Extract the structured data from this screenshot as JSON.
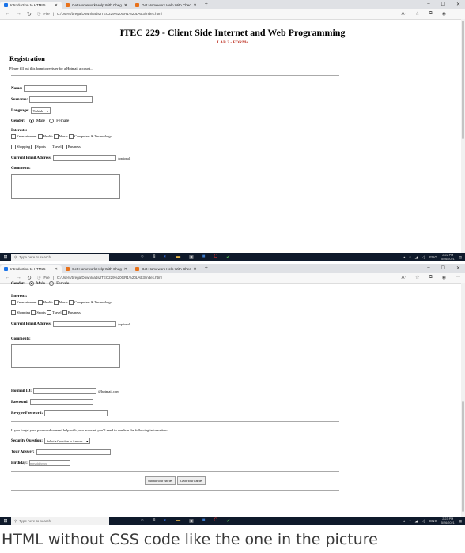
{
  "browser": {
    "tabs": [
      {
        "title": "Introduction to HTML5",
        "color": "#1a73e8"
      },
      {
        "title": "Get Homework Help With Cheg",
        "color": "#e8711a"
      },
      {
        "title": "Get Homework Help With Chec",
        "color": "#e8711a"
      }
    ],
    "new_tab": "+",
    "window_controls": [
      "–",
      "☐",
      "✕"
    ],
    "file_label": "File",
    "url": "C:/Users/brega/Downloads/ITEC229%20GR1%20LAB3/index.html"
  },
  "page": {
    "title": "ITEC 229 - Client Side Internet and Web Programming",
    "subtitle": "LAB 3 - FORMs",
    "heading": "Registration",
    "intro": "Please fill out this form to register for a Hotmail account...",
    "name_label": "Name:",
    "surname_label": "Surname:",
    "language_label": "Language:",
    "language_value": "Turkish",
    "gender_label": "Gender:",
    "gender_options": [
      "Male",
      "Female"
    ],
    "interests_label": "Interests:",
    "interests_row1": [
      "Entertainment",
      "Health",
      "Music",
      "Computers & Technology"
    ],
    "interests_row2": [
      "Shopping",
      "Sports",
      "Travel",
      "Business"
    ],
    "email_label": "Current Email Address:",
    "email_optional": "(optional)",
    "comments_label": "Comments:",
    "hotmail_label": "Hotmail ID:",
    "hotmail_suffix": "@hotmail.com",
    "password_label": "Password:",
    "retype_label": "Re-type Password:",
    "forgot_text": "If you forget your password or need help with your account, you'll need to confirm the following information:",
    "security_label": "Security Question:",
    "security_value": "Select a Question to Answer",
    "answer_label": "Your Answer:",
    "birthday_label": "Birthday:",
    "birthday_placeholder": "mm/dd/yyyy",
    "submit_label": "Submit Your Entries",
    "clear_label": "Clear Your Entries"
  },
  "taskbar": {
    "search_placeholder": "Type here to search",
    "lang": "ENG",
    "clock1_time": "2:22 PM",
    "clock1_date": "5/26/2021",
    "clock2_time": "2:23 PM",
    "clock2_date": "5/26/2021"
  },
  "caption": "HTML without CSS code like the one in the picture"
}
